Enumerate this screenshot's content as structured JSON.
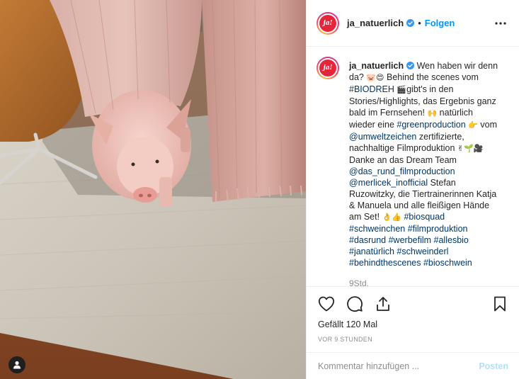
{
  "post": {
    "username": "ja_natuerlich",
    "follow_label": "Folgen",
    "separator": "•",
    "avatar_text": "ja!",
    "photo_alt": "Ferkel unter einer rosa Strickdecke auf einem Teppich"
  },
  "caption": {
    "username": "ja_natuerlich",
    "segments": [
      {
        "t": "text",
        "v": " Wen haben wir denn da? "
      },
      {
        "t": "emoji",
        "v": "🐷😍"
      },
      {
        "t": "text",
        "v": " Behind the scenes vom "
      },
      {
        "t": "tag",
        "v": "#BIODREH"
      },
      {
        "t": "text",
        "v": " "
      },
      {
        "t": "emoji",
        "v": "🎬"
      },
      {
        "t": "text",
        "v": "gibt's in den Stories/Highlights, das Ergebnis ganz bald im Fernsehen! "
      },
      {
        "t": "emoji",
        "v": "🙌"
      },
      {
        "t": "text",
        "v": " natürlich wieder eine "
      },
      {
        "t": "tag",
        "v": "#greenproduction"
      },
      {
        "t": "text",
        "v": " "
      },
      {
        "t": "emoji",
        "v": "👉"
      },
      {
        "t": "text",
        "v": " vom "
      },
      {
        "t": "tag",
        "v": "@umweltzeichen"
      },
      {
        "t": "text",
        "v": " zertifizierte, nachhaltige Filmproduktion "
      },
      {
        "t": "emoji",
        "v": "✌🌱🎥"
      },
      {
        "t": "text",
        "v": " Danke an das Dream Team "
      },
      {
        "t": "tag",
        "v": "@das_rund_filmproduction"
      },
      {
        "t": "text",
        "v": " "
      },
      {
        "t": "tag",
        "v": "@merlicek_inofficial"
      },
      {
        "t": "text",
        "v": " Stefan Ruzowitzky, die Tiertrainerinnen Katja & Manuela und alle fleißigen Hände am Set! "
      },
      {
        "t": "emoji",
        "v": "👌👍"
      },
      {
        "t": "text",
        "v": " "
      },
      {
        "t": "tag",
        "v": "#biosquad"
      },
      {
        "t": "text",
        "v": " "
      },
      {
        "t": "tag",
        "v": "#schweinchen"
      },
      {
        "t": "text",
        "v": " "
      },
      {
        "t": "tag",
        "v": "#filmproduktion"
      },
      {
        "t": "text",
        "v": " "
      },
      {
        "t": "tag",
        "v": "#dasrund"
      },
      {
        "t": "text",
        "v": " "
      },
      {
        "t": "tag",
        "v": "#werbefilm"
      },
      {
        "t": "text",
        "v": " "
      },
      {
        "t": "tag",
        "v": "#allesbio"
      },
      {
        "t": "text",
        "v": " "
      },
      {
        "t": "tag",
        "v": "#janatürlich"
      },
      {
        "t": "text",
        "v": " "
      },
      {
        "t": "tag",
        "v": "#schweinderl"
      },
      {
        "t": "text",
        "v": " "
      },
      {
        "t": "tag",
        "v": "#behindthescenes"
      },
      {
        "t": "text",
        "v": " "
      },
      {
        "t": "tag",
        "v": "#bioschwein"
      }
    ],
    "timestamp": "9Std."
  },
  "actions": {
    "likes_label": "Gefällt 120 Mal",
    "time_ago": "VOR 9 STUNDEN",
    "icons": [
      "heart-icon",
      "comment-icon",
      "share-icon",
      "bookmark-icon"
    ]
  },
  "comment": {
    "placeholder": "Kommentar hinzufügen ...",
    "post_label": "Posten"
  },
  "colors": {
    "link": "#00376b",
    "follow": "#0095f6",
    "post_disabled": "#b2dffc",
    "secondary_text": "#8e8e8e",
    "verified": "#3897f0"
  }
}
